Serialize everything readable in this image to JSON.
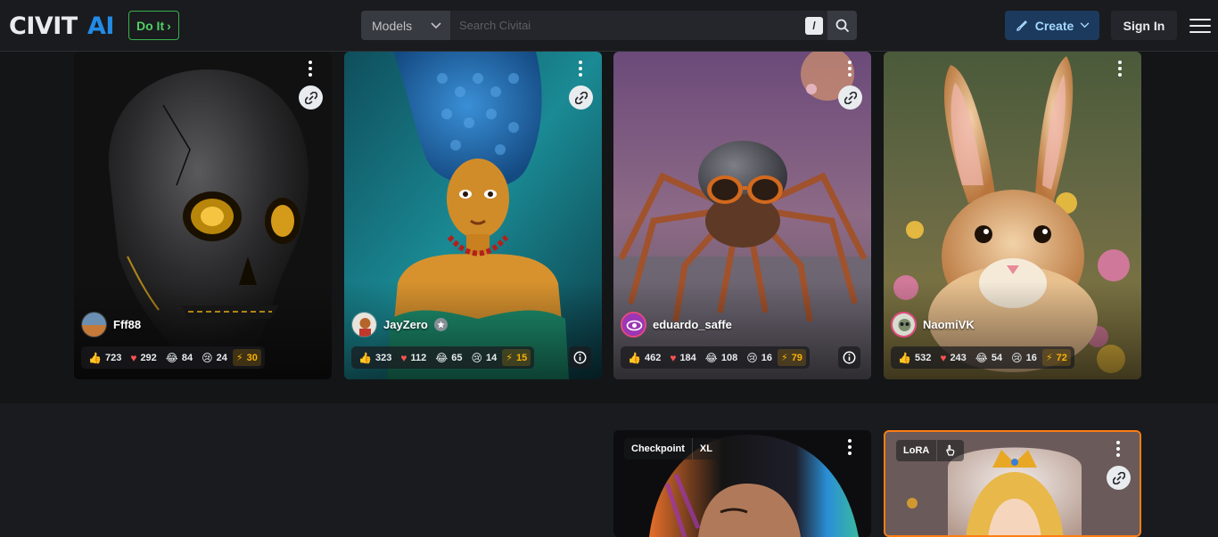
{
  "header": {
    "logo_text": "CIVITAI",
    "doit_label": "Do It",
    "models_select": "Models",
    "search_placeholder": "Search Civitai",
    "search_shortcut": "/",
    "create_label": "Create",
    "signin_label": "Sign In"
  },
  "cards": [
    {
      "username": "Fff88",
      "likes": "723",
      "hearts": "292",
      "laughs": "84",
      "cries": "24",
      "buzz": "30"
    },
    {
      "username": "JayZero",
      "likes": "323",
      "hearts": "112",
      "laughs": "65",
      "cries": "14",
      "buzz": "15"
    },
    {
      "username": "eduardo_saffe",
      "likes": "462",
      "hearts": "184",
      "laughs": "108",
      "cries": "16",
      "buzz": "79"
    },
    {
      "username": "NaomiVK",
      "likes": "532",
      "hearts": "243",
      "laughs": "54",
      "cries": "16",
      "buzz": "72"
    }
  ],
  "models": [
    {
      "tags": [
        "Checkpoint",
        "XL"
      ]
    },
    {
      "tags": [
        "LoRA"
      ]
    }
  ],
  "colors": {
    "accent_blue": "#228be6",
    "doit_green": "#51cf66",
    "buzz_yellow": "#fab005",
    "heart_red": "#fa5252"
  }
}
